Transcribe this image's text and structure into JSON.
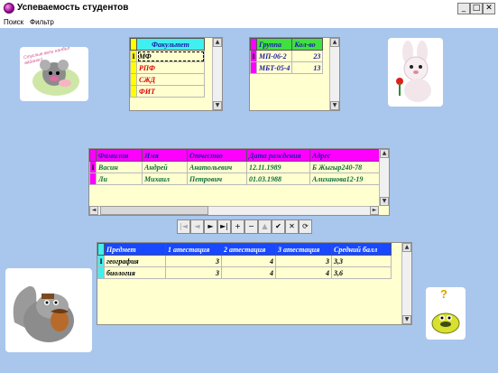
{
  "window": {
    "title": "Успеваемость студентов"
  },
  "menu": [
    {
      "label": "Поиск"
    },
    {
      "label": "Фильтр"
    }
  ],
  "faculty_grid": {
    "header": "Факультет",
    "rows": [
      {
        "name": "МФ"
      },
      {
        "name": "РПФ"
      },
      {
        "name": "СЖД"
      },
      {
        "name": "ФИТ"
      }
    ]
  },
  "group_grid": {
    "headers": [
      "Группа",
      "Кол-во"
    ],
    "rows": [
      [
        "МП-06-2",
        "23"
      ],
      [
        "МБТ-05-4",
        "13"
      ]
    ]
  },
  "students_grid": {
    "headers": [
      "Фамилия",
      "Имя",
      "Отчество",
      "Дата рождения",
      "Адрес"
    ],
    "rows": [
      [
        "Васин",
        "Андрей",
        "Анатольевич",
        "12.11.1989",
        "Б Жыгыр240-78"
      ],
      [
        "Ли",
        "Михаил",
        "Петрович",
        "01.03.1988",
        "Алиханова12-19"
      ]
    ]
  },
  "grades_grid": {
    "headers": [
      "Предмет",
      "1 атестация",
      "2 атестация",
      "3 атестация",
      "Средний балл"
    ],
    "rows": [
      [
        "география",
        "3",
        "4",
        "3",
        "3,3"
      ],
      [
        "биология",
        "3",
        "4",
        "4",
        "3,6"
      ]
    ]
  },
  "navigator": [
    {
      "icon": "first-record-icon",
      "glyph": "|◄",
      "enabled": false
    },
    {
      "icon": "prior-record-icon",
      "glyph": "◄",
      "enabled": false
    },
    {
      "icon": "next-record-icon",
      "glyph": "►",
      "enabled": true
    },
    {
      "icon": "last-record-icon",
      "glyph": "►|",
      "enabled": true
    },
    {
      "icon": "insert-record-icon",
      "glyph": "+",
      "enabled": true
    },
    {
      "icon": "delete-record-icon",
      "glyph": "−",
      "enabled": true
    },
    {
      "icon": "edit-record-icon",
      "glyph": "▲",
      "enabled": false
    },
    {
      "icon": "post-edit-icon",
      "glyph": "✔",
      "enabled": true
    },
    {
      "icon": "cancel-edit-icon",
      "glyph": "✕",
      "enabled": true
    },
    {
      "icon": "refresh-data-icon",
      "glyph": "⟳",
      "enabled": true
    }
  ],
  "sticker_text": "Стуслые вели налбъл вайанос)",
  "sticker_question": "?",
  "colors": {
    "background": "#a9c7ed",
    "grid_bg": "#ffffd0",
    "faculty_header": "#40f0f0",
    "faculty_text": "#e00000",
    "group_header": "#40e040",
    "magenta_header": "#ff00ff",
    "blue_header": "#1848ff",
    "indicator_faculty": "#ffff00",
    "indicator_group": "#ff00ff",
    "indicator_students": "#ff00ff",
    "indicator_grades": "#40f0f0"
  }
}
